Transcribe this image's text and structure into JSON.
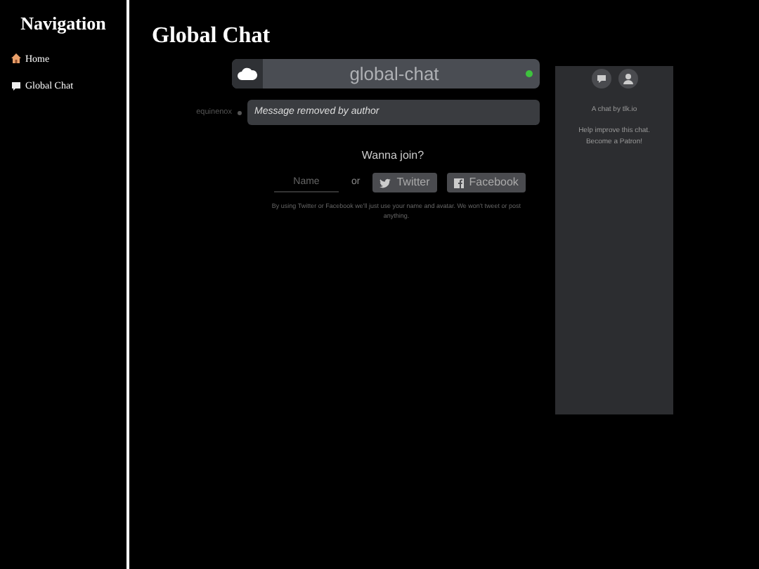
{
  "sidebar": {
    "title": "Navigation",
    "items": [
      {
        "label": "Home",
        "kind": "home"
      },
      {
        "label": "Global Chat",
        "kind": "chat"
      }
    ]
  },
  "page": {
    "title": "Global Chat"
  },
  "chat": {
    "channel": "global-chat",
    "online": true,
    "messages": [
      {
        "user": "equinenox",
        "text": "Message removed by author"
      }
    ],
    "join": {
      "heading": "Wanna join?",
      "name_placeholder": "Name",
      "or": "or",
      "buttons": [
        {
          "label": "Twitter",
          "kind": "twitter"
        },
        {
          "label": "Facebook",
          "kind": "facebook"
        }
      ],
      "disclaimer": "By using Twitter or Facebook we'll just use your name and avatar. We won't tweet or post anything."
    }
  },
  "side_panel": {
    "credit": "A chat by tlk.io",
    "help": [
      "Help improve this chat.",
      "Become a Patron!"
    ]
  }
}
